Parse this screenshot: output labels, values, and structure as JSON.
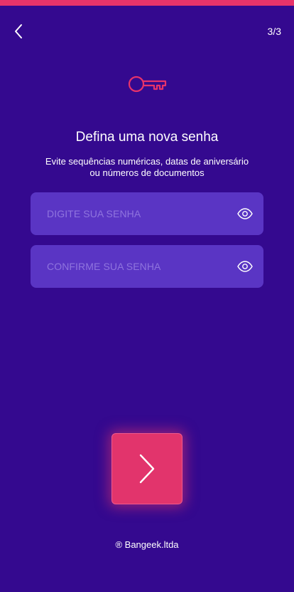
{
  "header": {
    "step": "3/3"
  },
  "content": {
    "title": "Defina uma nova senha",
    "subtitle": "Evite sequências numéricas, datas de aniversário ou números de documentos"
  },
  "form": {
    "password_placeholder": "DIGITE SUA SENHA",
    "password_value": "",
    "confirm_placeholder": "CONFIRME SUA SENHA",
    "confirm_value": ""
  },
  "footer": {
    "copyright": "® Bangeek.ltda"
  },
  "icons": {
    "back": "chevron-left-icon",
    "key": "key-icon",
    "eye": "eye-icon",
    "next": "chevron-right-icon"
  },
  "colors": {
    "background": "#34098f",
    "accent": "#e8336a",
    "field_background": "#5a35c4",
    "placeholder": "#8f74de"
  }
}
